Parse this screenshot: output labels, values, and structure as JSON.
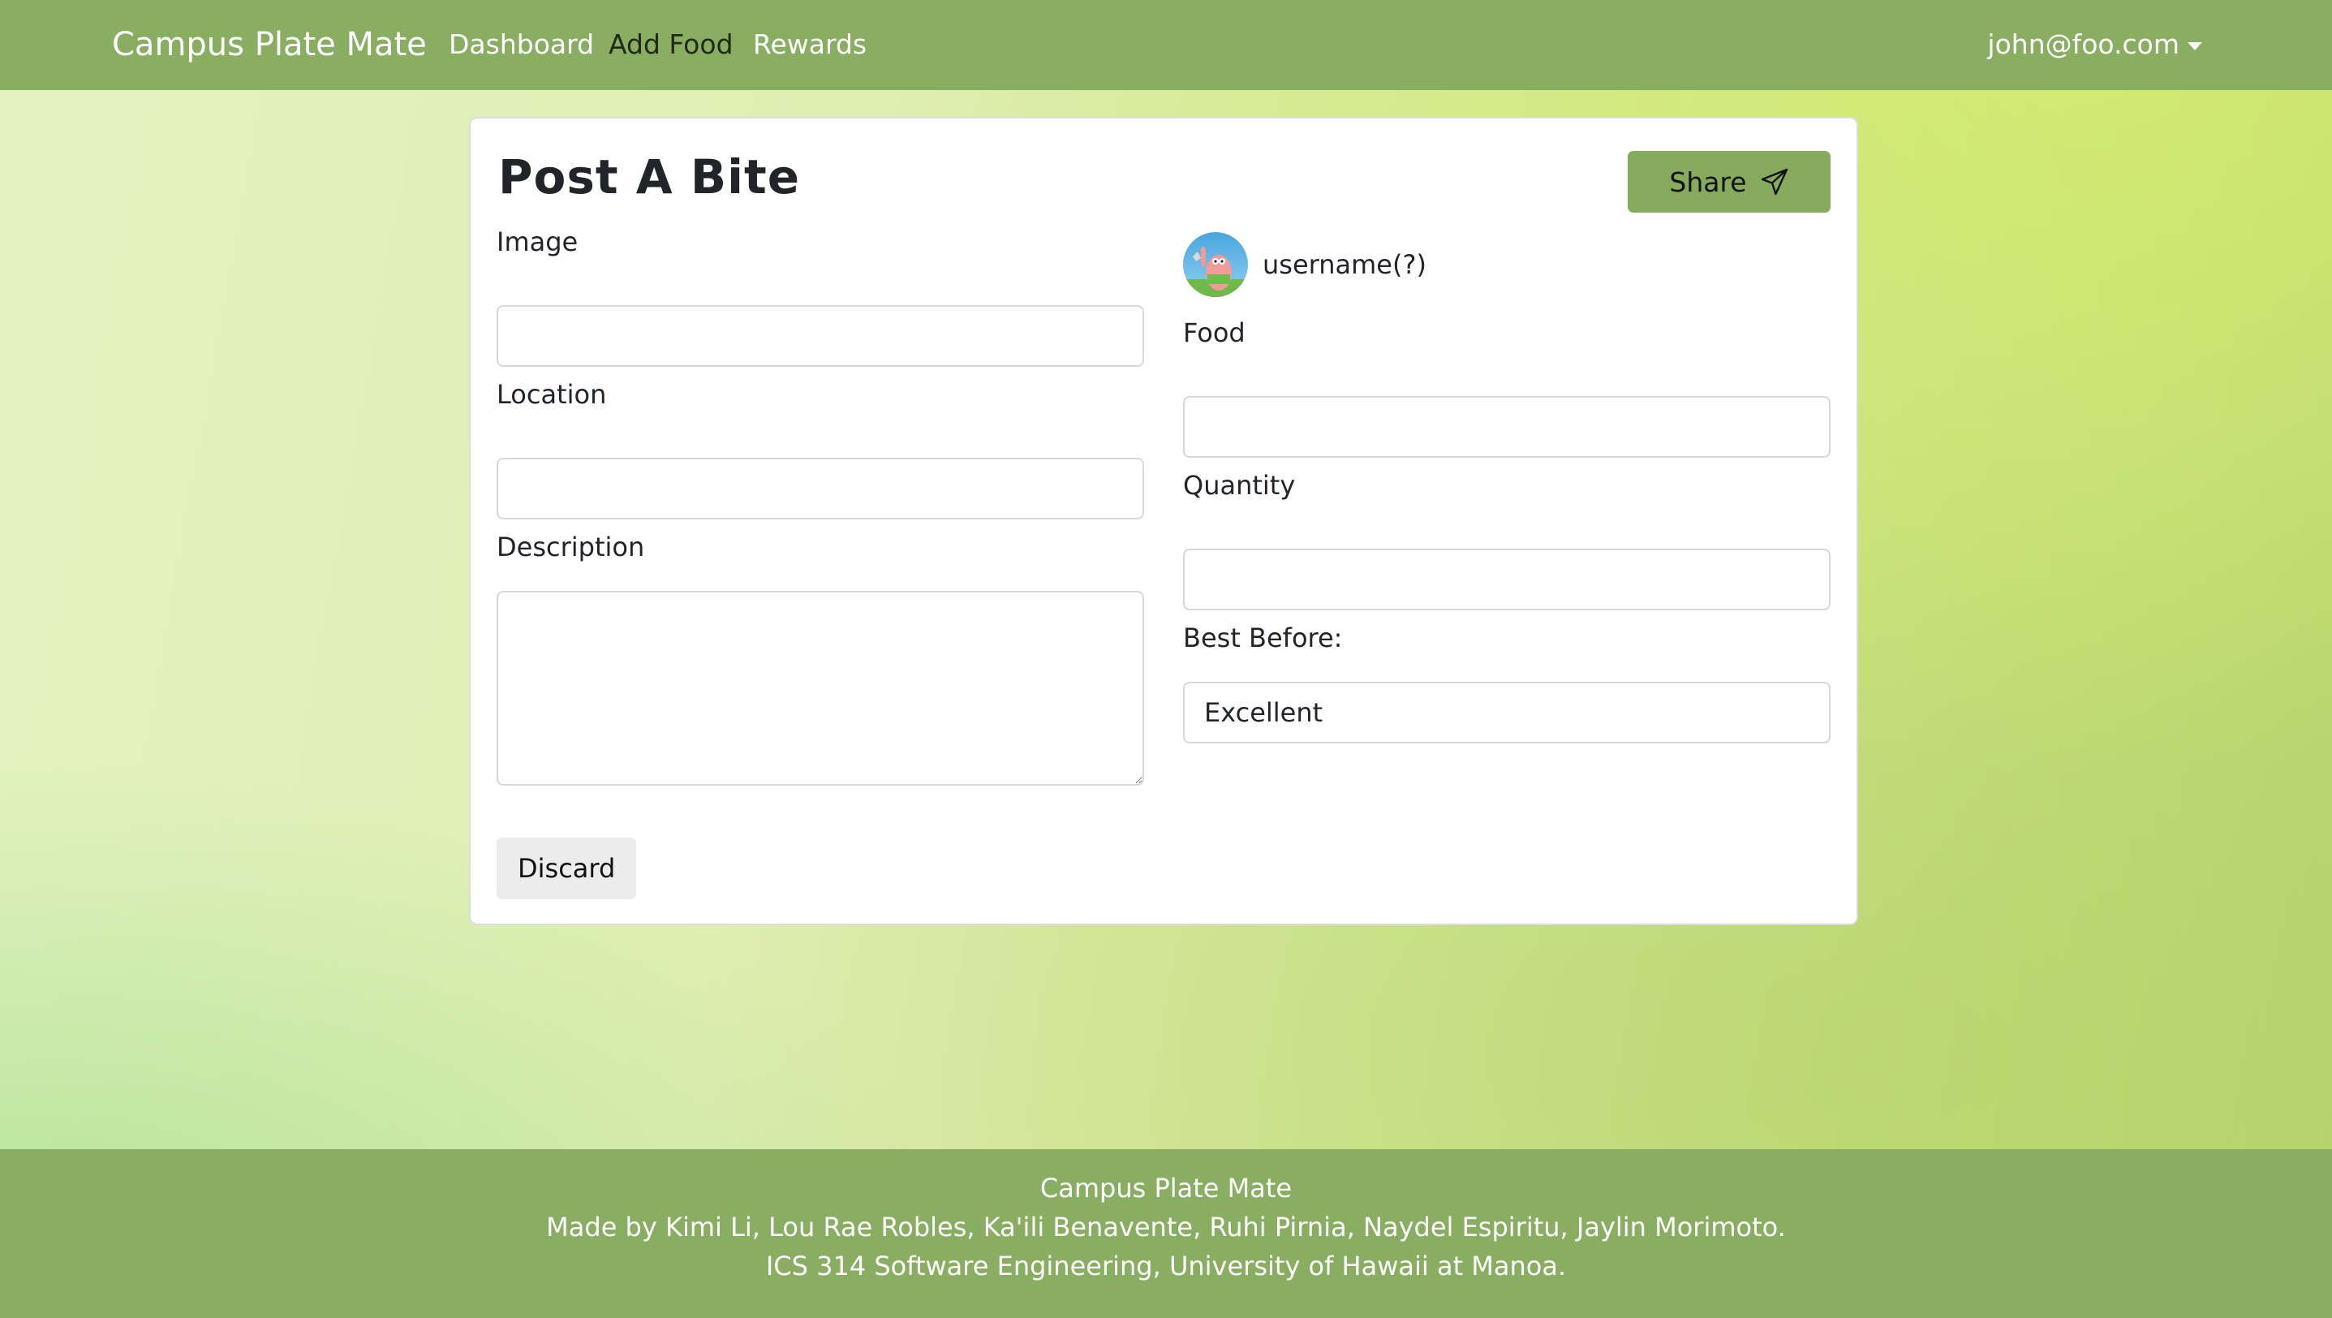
{
  "navbar": {
    "brand": "Campus Plate Mate",
    "links": [
      "Dashboard",
      "Add Food",
      "Rewards"
    ],
    "user": "john@foo.com"
  },
  "form": {
    "title": "Post A Bite",
    "share_label": "Share",
    "username": "username(?)",
    "image_label": "Image",
    "image_value": "",
    "location_label": "Location",
    "location_value": "",
    "description_label": "Description",
    "description_value": "",
    "food_label": "Food",
    "food_value": "",
    "quantity_label": "Quantity",
    "quantity_value": "",
    "best_before_label": "Best Before:",
    "best_before_value": "Excellent",
    "discard_label": "Discard"
  },
  "footer": {
    "line1": "Campus Plate Mate",
    "line2": "Made by Kimi Li, Lou Rae Robles, Ka'ili Benavente, Ruhi Pirnia, Naydel Espiritu, Jaylin Morimoto.",
    "line3": "ICS 314 Software Engineering, University of Hawaii at Manoa."
  },
  "colors": {
    "navbar": "#89ae62",
    "share_button": "#86ab5c",
    "discard_button": "#ececec"
  },
  "icons": {
    "share": "send-icon",
    "user_menu": "caret-down-icon",
    "avatar": "avatar-image"
  }
}
